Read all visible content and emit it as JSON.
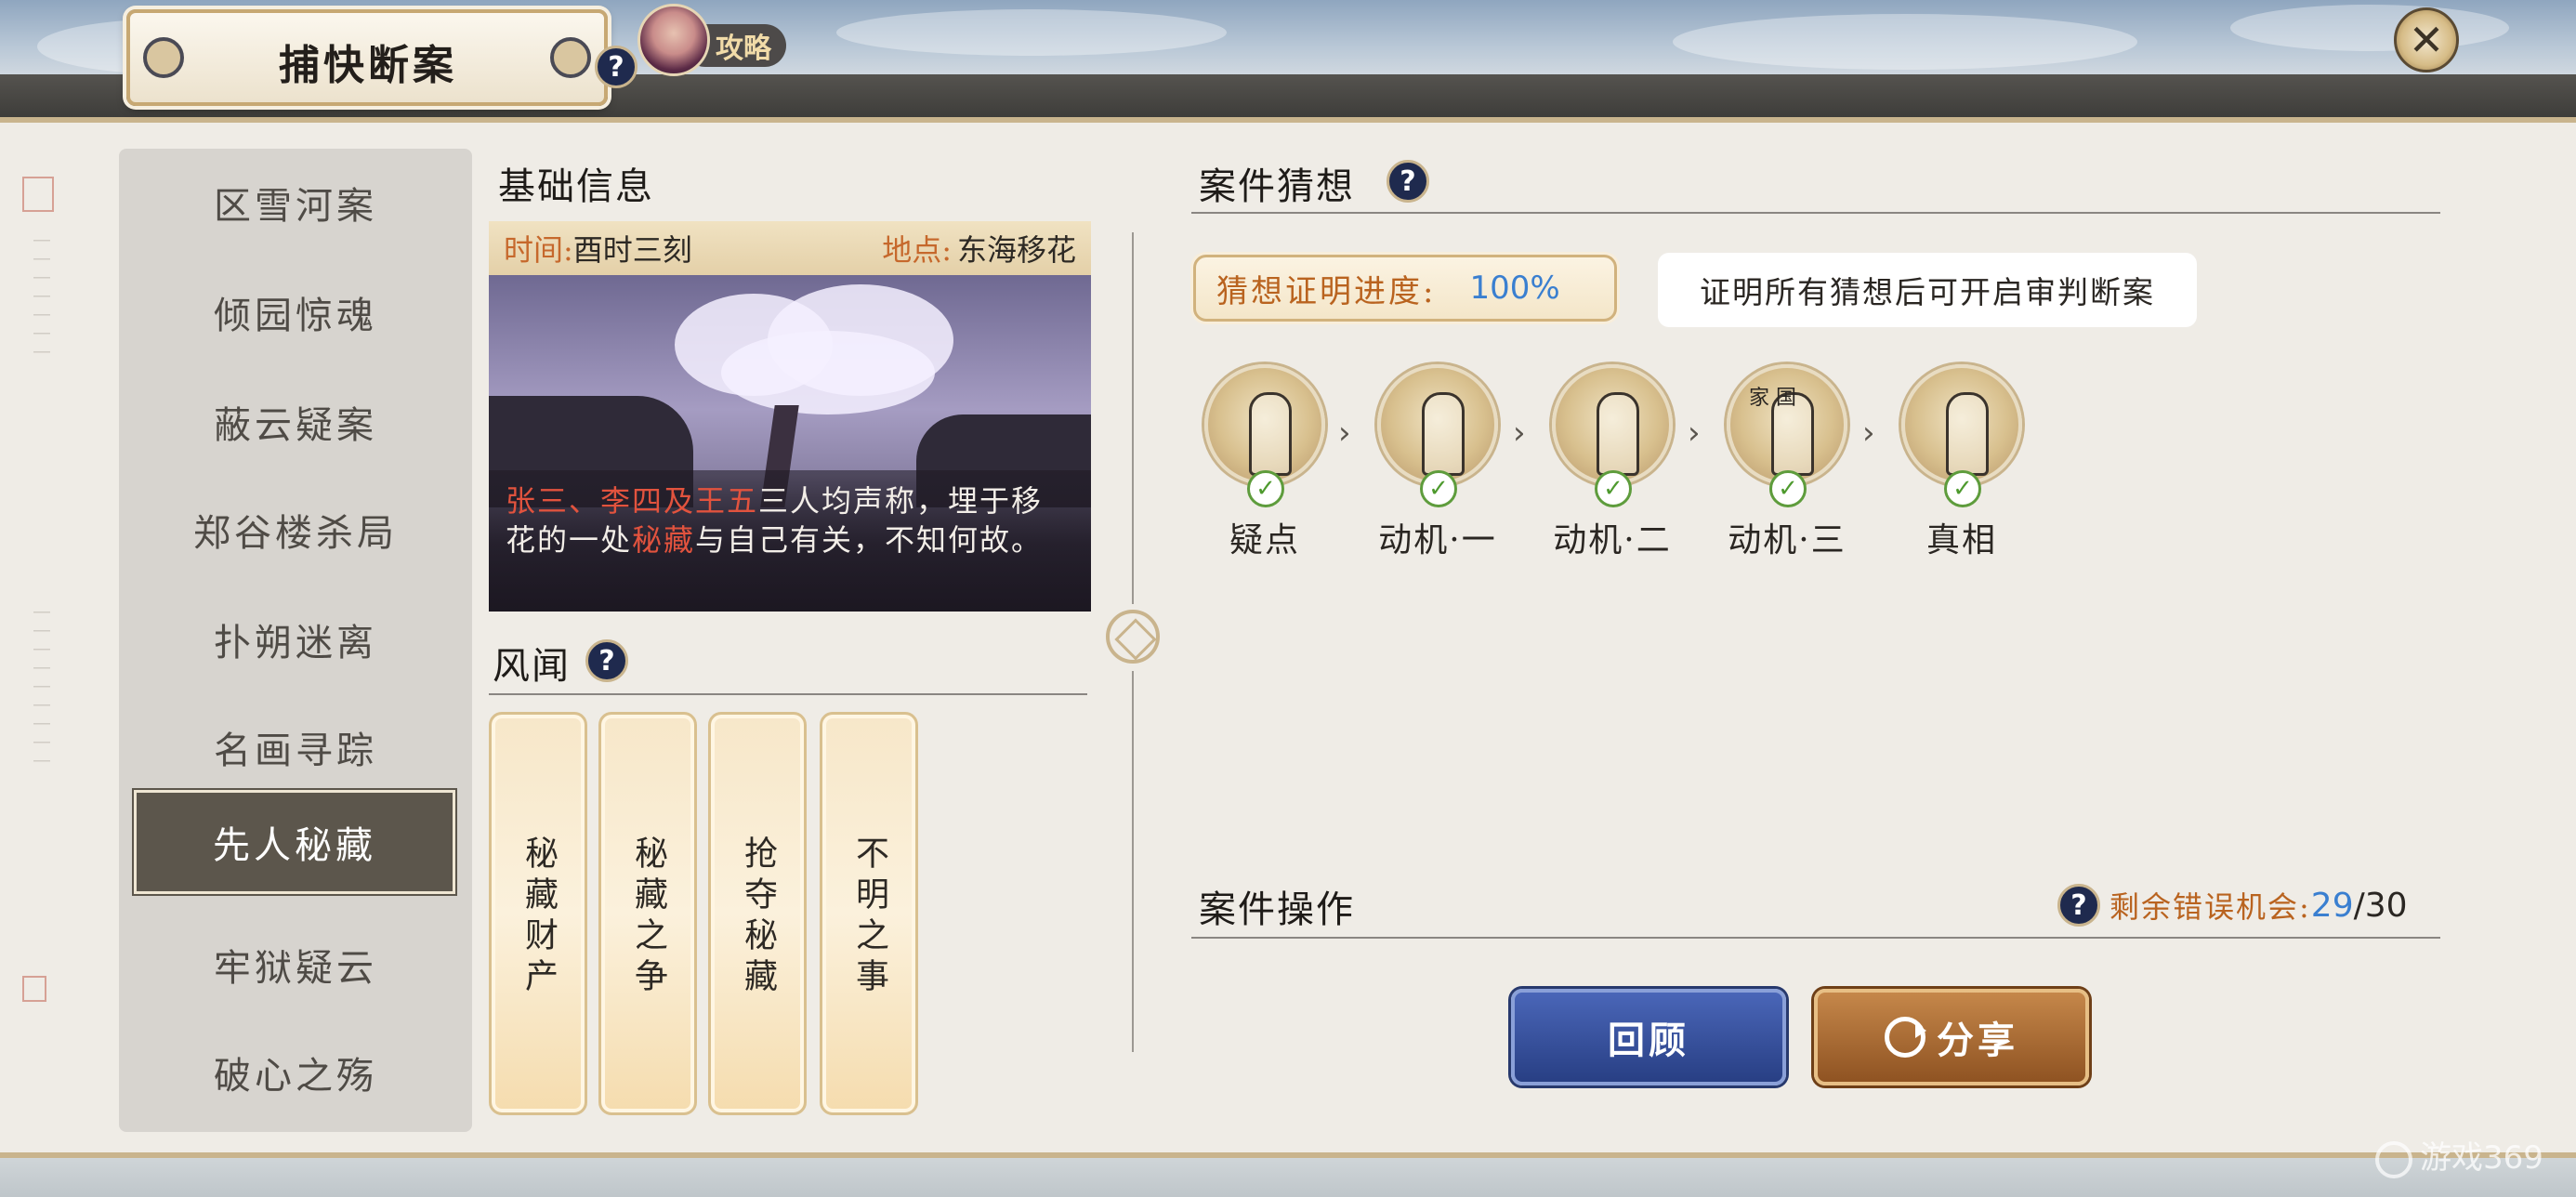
{
  "header": {
    "title": "捕快断案",
    "help_icon": "?",
    "guide_label": "攻略",
    "close_icon": "✕"
  },
  "case_list": {
    "items": [
      {
        "label": "区雪河案",
        "active": false
      },
      {
        "label": "倾园惊魂",
        "active": false,
        "has_new_dot": true
      },
      {
        "label": "蔽云疑案",
        "active": false
      },
      {
        "label": "郑谷楼杀局",
        "active": false
      },
      {
        "label": "扑朔迷离",
        "active": false
      },
      {
        "label": "名画寻踪",
        "active": false
      },
      {
        "label": "先人秘藏",
        "active": true
      },
      {
        "label": "牢狱疑云",
        "active": false
      },
      {
        "label": "破心之殇",
        "active": false
      }
    ]
  },
  "basic_info": {
    "heading": "基础信息",
    "time_label": "时间:",
    "time_value": "酉时三刻",
    "place_label": "地点:",
    "place_value": "东海移花",
    "desc_part1": "张三、李四及王五",
    "desc_part2": "三人均声称，埋于移花的一处",
    "desc_part3": "秘藏",
    "desc_part4": "与自己有关，不知何故。"
  },
  "rumors": {
    "heading": "风闻",
    "items": [
      "秘藏财产",
      "秘藏之争",
      "抢夺秘藏",
      "不明之事"
    ]
  },
  "guesses": {
    "heading": "案件猜想",
    "progress_label": "猜想证明进度:",
    "progress_value": "100%",
    "tip": "证明所有猜想后可开启审判断案",
    "clues": [
      {
        "name": "疑点",
        "checked": true
      },
      {
        "name": "动机·一",
        "checked": true
      },
      {
        "name": "动机·二",
        "checked": true
      },
      {
        "name": "动机·三",
        "checked": true
      },
      {
        "name": "真相",
        "checked": true
      }
    ],
    "clue_badge_text": "家 国"
  },
  "operations": {
    "heading": "案件操作",
    "mistakes_label": "剩余错误机会:",
    "mistakes_current": "29",
    "mistakes_total": "/30",
    "review_button": "回顾",
    "share_button": "分享"
  },
  "watermark": "游戏369",
  "colors": {
    "accent_orange": "#b9631f",
    "accent_blue": "#3a7fd0",
    "highlight_red": "#e2533e"
  }
}
